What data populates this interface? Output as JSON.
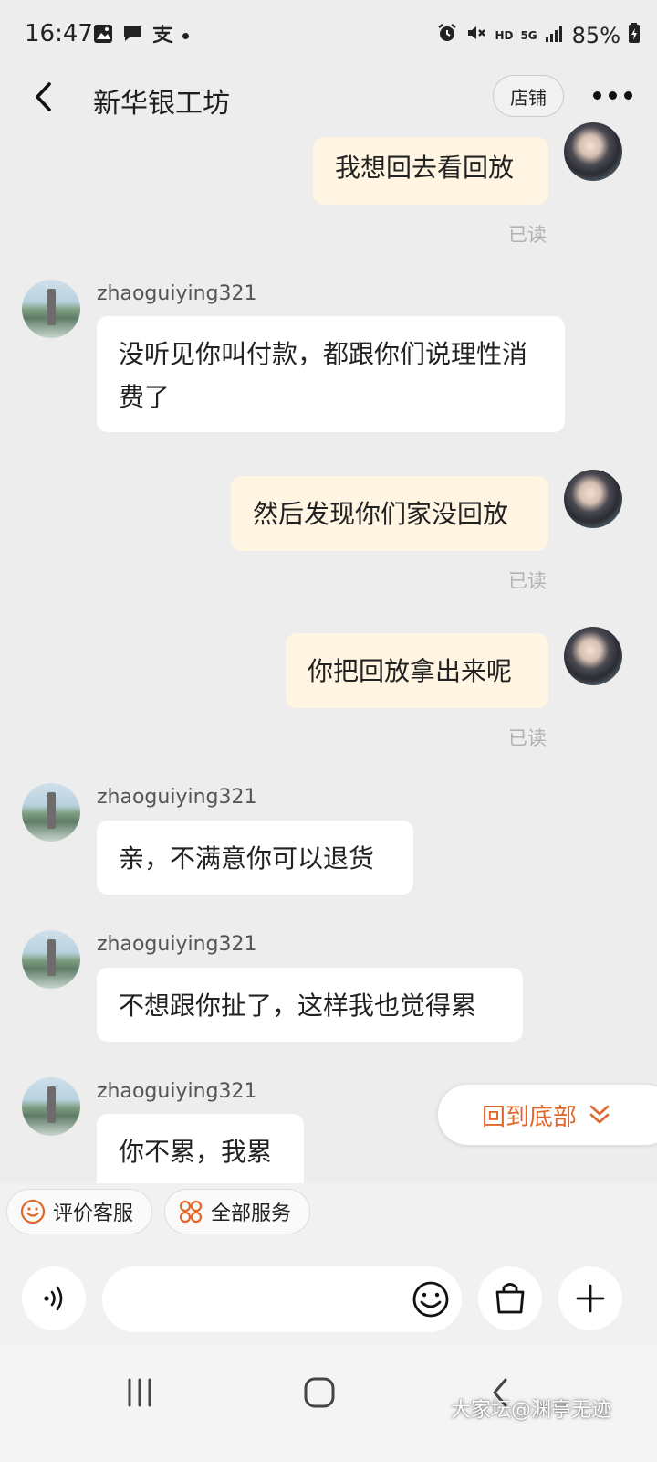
{
  "status_bar": {
    "time": "16:47",
    "battery": "85%",
    "network": "5G",
    "hd": "HD",
    "left_icons": [
      "image-icon",
      "chat-icon",
      "alipay-icon",
      "dot-icon"
    ],
    "right_icons": [
      "alarm-icon",
      "mute-icon",
      "hd-icon",
      "5g-icon",
      "signal-icon",
      "battery-icon"
    ]
  },
  "header": {
    "title": "新华银工坊",
    "shop_label": "店铺"
  },
  "messages": [
    {
      "side": "me",
      "text": "我想回去看回放",
      "status": "已读"
    },
    {
      "side": "them",
      "user": "zhaoguiying321",
      "text": "没听见你叫付款，都跟你们说理性消费了"
    },
    {
      "side": "me",
      "text": "然后发现你们家没回放",
      "status": "已读"
    },
    {
      "side": "me",
      "text": "你把回放拿出来呢",
      "status": "已读"
    },
    {
      "side": "them",
      "user": "zhaoguiying321",
      "text": "亲，不满意你可以退货"
    },
    {
      "side": "them",
      "user": "zhaoguiying321",
      "text": "不想跟你扯了，这样我也觉得累"
    },
    {
      "side": "them",
      "user": "zhaoguiying321",
      "text": "你不累，我累"
    }
  ],
  "scroll_to_bottom": "回到底部",
  "services": {
    "rate_label": "评价客服",
    "all_label": "全部服务"
  },
  "input": {
    "placeholder": ""
  },
  "watermark": "大家坛@渊亭无迹",
  "colors": {
    "accent": "#e0662a",
    "my_bubble": "#fff5e2",
    "their_bubble": "#ffffff",
    "background": "#ededed"
  }
}
